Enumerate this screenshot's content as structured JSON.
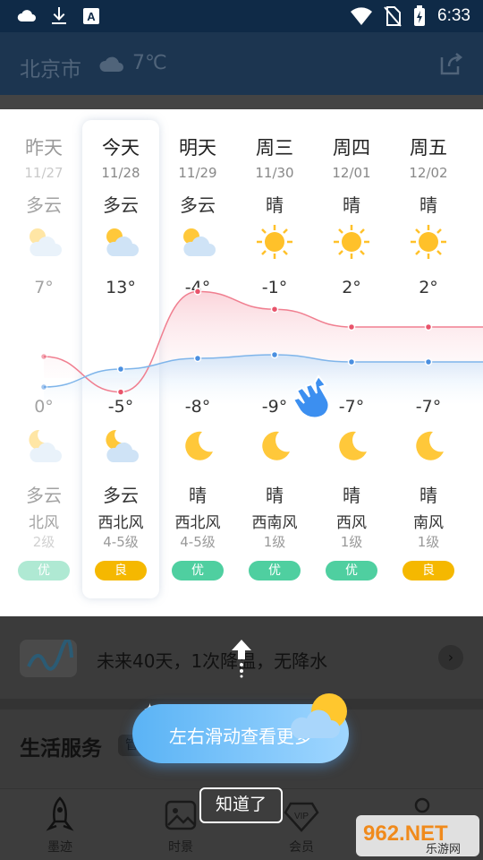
{
  "status_bar": {
    "time": "6:33",
    "icons": [
      "cloud-icon",
      "download-icon",
      "font-icon",
      "wifi-icon",
      "no-sim-icon",
      "battery-charging-icon"
    ]
  },
  "header": {
    "city": "北京市",
    "current_temp": "7℃",
    "weather_icon": "cloud-icon",
    "share_icon": "share-icon"
  },
  "forecast": {
    "days": [
      {
        "name": "昨天",
        "date": "11/27",
        "day_weather": "多云",
        "day_icon": "partly-cloudy",
        "high": "7°",
        "low": "0°",
        "night_icon": "moon-cloud",
        "night_weather": "多云",
        "wind": "北风",
        "wind_level": "2级",
        "aqi": "优",
        "aqi_color": "#4fcfa0",
        "high_value": 7,
        "low_value": 0
      },
      {
        "name": "今天",
        "date": "11/28",
        "day_weather": "多云",
        "day_icon": "partly-cloudy",
        "high": "13°",
        "low": "-5°",
        "night_icon": "moon-cloud",
        "night_weather": "多云",
        "wind": "西北风",
        "wind_level": "4-5级",
        "aqi": "良",
        "aqi_color": "#f5b800",
        "high_value": 13,
        "low_value": -5
      },
      {
        "name": "明天",
        "date": "11/29",
        "day_weather": "多云",
        "day_icon": "partly-cloudy",
        "high": "-4°",
        "low": "-8°",
        "night_icon": "moon",
        "night_weather": "晴",
        "wind": "西北风",
        "wind_level": "4-5级",
        "aqi": "优",
        "aqi_color": "#4fcfa0",
        "high_value": -4,
        "low_value": -8
      },
      {
        "name": "周三",
        "date": "11/30",
        "day_weather": "晴",
        "day_icon": "sun",
        "high": "-1°",
        "low": "-9°",
        "night_icon": "moon",
        "night_weather": "晴",
        "wind": "西南风",
        "wind_level": "1级",
        "aqi": "优",
        "aqi_color": "#4fcfa0",
        "high_value": -1,
        "low_value": -9
      },
      {
        "name": "周四",
        "date": "12/01",
        "day_weather": "晴",
        "day_icon": "sun",
        "high": "2°",
        "low": "-7°",
        "night_icon": "moon",
        "night_weather": "晴",
        "wind": "西风",
        "wind_level": "1级",
        "aqi": "优",
        "aqi_color": "#4fcfa0",
        "high_value": 2,
        "low_value": -7
      },
      {
        "name": "周五",
        "date": "12/02",
        "day_weather": "晴",
        "day_icon": "sun",
        "high": "2°",
        "low": "-7°",
        "night_icon": "moon",
        "night_weather": "晴",
        "wind": "南风",
        "wind_level": "1级",
        "aqi": "良",
        "aqi_color": "#f5b800",
        "high_value": 2,
        "low_value": -7
      }
    ],
    "high_line_color": "#f07f90",
    "low_line_color": "#7fb5ea"
  },
  "trend": {
    "text": "未来40天，1次降温，无降水"
  },
  "services": {
    "title": "生活服务",
    "tag": "管"
  },
  "tabs": [
    {
      "label": "墨迹",
      "icon": "rocket-icon"
    },
    {
      "label": "时景",
      "icon": "image-icon"
    },
    {
      "label": "会员",
      "icon": "vip-icon"
    }
  ],
  "coach": {
    "tip": "左右滑动查看更多",
    "ok_label": "知道了"
  },
  "watermark": {
    "text": "962.NET",
    "sub": "乐游网"
  }
}
